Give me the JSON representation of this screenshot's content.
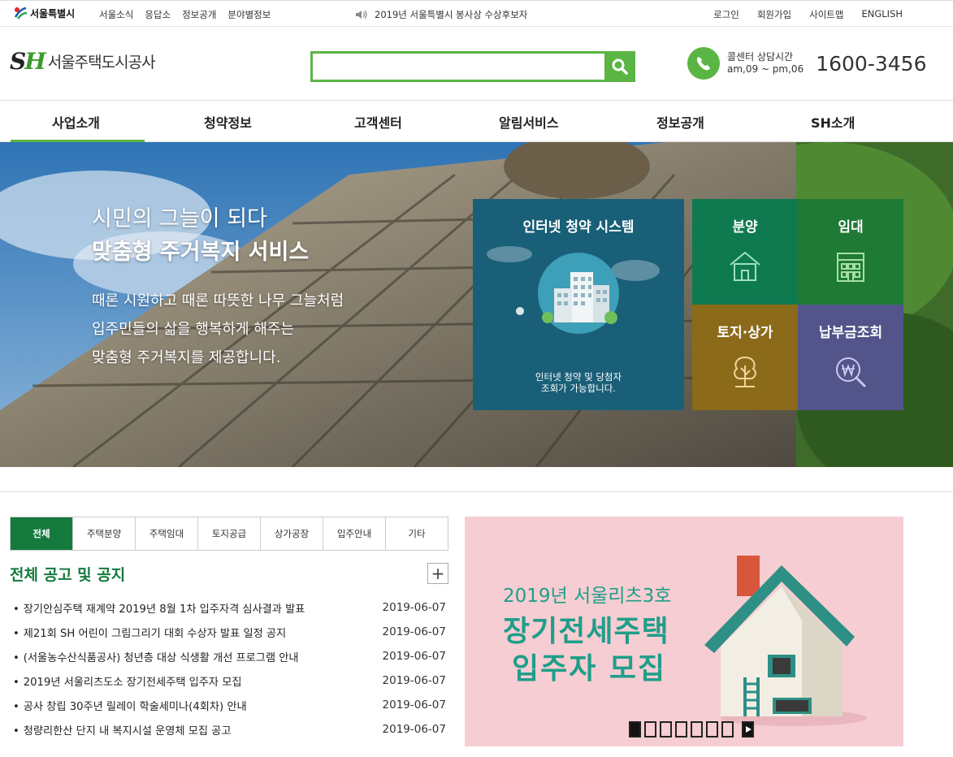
{
  "topbar": {
    "seoul_logo": "서울특별시",
    "links": [
      "서울소식",
      "응답소",
      "정보공개",
      "분야별정보"
    ],
    "notice": "2019년 서울특별시 봉사상 수상후보자",
    "util_links": [
      "로그인",
      "회원가입",
      "사이트맵",
      "ENGLISH"
    ]
  },
  "header": {
    "logo_mark": "SH",
    "logo_name": "서울주택도시공사",
    "search_placeholder": "",
    "call_label": "콜센터 상담시간",
    "call_hours": "am,09 ~ pm,06",
    "call_number": "1600-3456"
  },
  "gnb": {
    "items": [
      "사업소개",
      "청약정보",
      "고객센터",
      "알림서비스",
      "정보공개",
      "SH소개"
    ],
    "active_index": 0
  },
  "hero": {
    "title1": "시민의 그늘이 되다",
    "title2": "맞춤형 주거복지 서비스",
    "desc1": "때론 시원하고 때론 따뜻한 나무 그늘처럼",
    "desc2": "입주민들의 삶을 행복하게 해주는",
    "desc3": "맞춤형 주거복지를 제공합니다."
  },
  "tiles": {
    "internet_title": "인터넷 청약 시스템",
    "internet_desc1": "인터넷 청약 및 당첨자",
    "internet_desc2": "조회가 가능합니다.",
    "sale": "분양",
    "rent": "임대",
    "land": "토지·상가",
    "pay": "납부금조회",
    "colors": {
      "internet": "#1a5f78",
      "sale": "#0f7a4f",
      "rent": "#1f7a35",
      "land": "#8b6a1a",
      "pay": "#52548a"
    }
  },
  "board": {
    "tabs": [
      "전체",
      "주택분양",
      "주택임대",
      "토지공급",
      "상가공장",
      "입주안내",
      "기타"
    ],
    "active_tab": 0,
    "title": "전체 공고 및 공지",
    "more": "+",
    "items": [
      {
        "title": "장기안심주택 재계약 2019년 8월 1차 입주자격 심사결과 발표",
        "date": "2019-06-07"
      },
      {
        "title": "제21회 SH 어린이 그림그리기 대회 수상자 발표 일정 공지",
        "date": "2019-06-07"
      },
      {
        "title": "(서울농수산식품공사) 청년층 대상 식생활 개선 프로그램 안내",
        "date": "2019-06-07"
      },
      {
        "title": "2019년 서울리츠도소 장기전세주택 입주자 모집",
        "date": "2019-06-07"
      },
      {
        "title": "공사 창립 30주년 릴레이 학술세미나(4회차) 안내",
        "date": "2019-06-07"
      },
      {
        "title": "청량리한산 단지 내 복지시설 운영체 모집 공고",
        "date": "2019-06-07"
      }
    ]
  },
  "banner": {
    "sub": "2019년 서울리츠3호",
    "main1": "장기전세주택",
    "main2": "입주자 모집",
    "slide_count": 7,
    "active_slide": 0,
    "accent": "#1f9e8a"
  }
}
